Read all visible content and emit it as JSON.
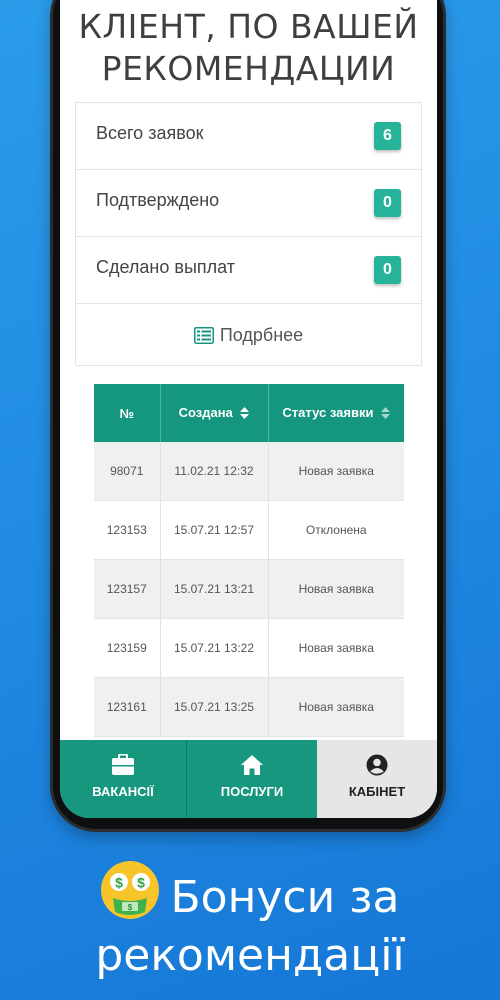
{
  "page": {
    "title": "КЛІЕНТ, ПО ВАШЕЙ РЕКОМЕНДАЦИИ",
    "title_line1": "КЛІЕНТ, ПО ВАШЕЙ",
    "title_line2": "РЕКОМЕНДАЦИИ"
  },
  "stats": [
    {
      "label": "Всего заявок",
      "value": "6"
    },
    {
      "label": "Подтверждено",
      "value": "0"
    },
    {
      "label": "Сделано выплат",
      "value": "0"
    }
  ],
  "more_link": {
    "label": "Подрбнее",
    "icon": "list-icon"
  },
  "table": {
    "headers": [
      "№",
      "Создана",
      "Статус заявки"
    ],
    "rows": [
      [
        "98071",
        "11.02.21 12:32",
        "Новая заявка"
      ],
      [
        "123153",
        "15.07.21 12:57",
        "Отклонена"
      ],
      [
        "123157",
        "15.07.21 13:21",
        "Новая заявка"
      ],
      [
        "123159",
        "15.07.21 13:22",
        "Новая заявка"
      ],
      [
        "123161",
        "15.07.21 13:25",
        "Новая заявка"
      ]
    ]
  },
  "bottom_nav": [
    {
      "label": "ВАКАНСІЇ",
      "icon": "briefcase-icon",
      "active": false
    },
    {
      "label": "ПОСЛУГИ",
      "icon": "home-icon",
      "active": false
    },
    {
      "label": "КАБІНЕТ",
      "icon": "user-circle-icon",
      "active": true
    }
  ],
  "caption": {
    "line1": "Бонуси за",
    "line2": "рекомендації",
    "icon": "money-mouth-face-icon"
  },
  "colors": {
    "accent": "#14977e",
    "badge": "#26b399",
    "background": "#1f88e0"
  }
}
